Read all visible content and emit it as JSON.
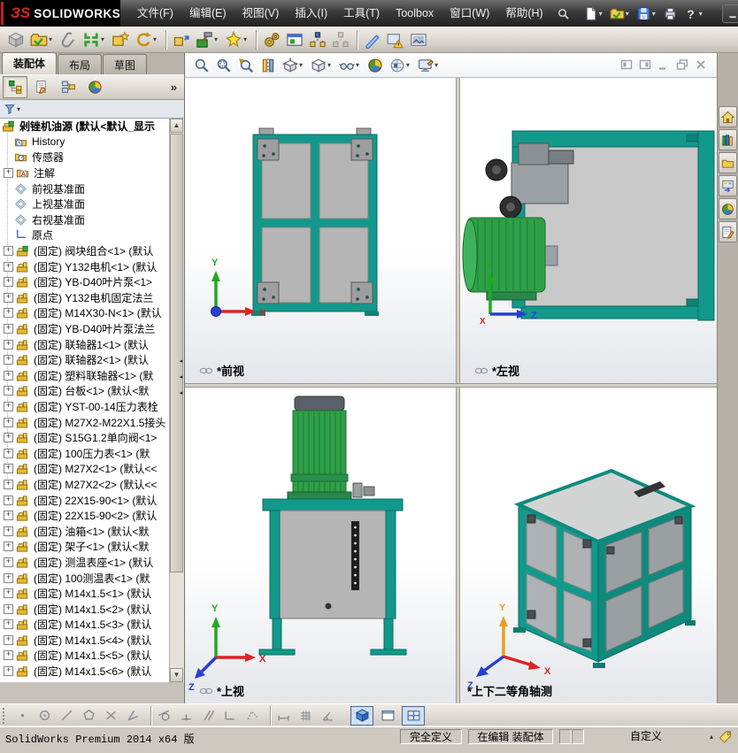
{
  "window": {
    "logo_mark": "ЗS",
    "logo_name": "SOLIDWORKS",
    "menus": [
      "文件(F)",
      "编辑(E)",
      "视图(V)",
      "插入(I)",
      "工具(T)",
      "Toolbox",
      "窗口(W)",
      "帮助(H)"
    ],
    "quick_actions": [
      {
        "icon": "new-doc",
        "dd": true
      },
      {
        "icon": "folder-open",
        "dd": true
      },
      {
        "icon": "save",
        "dd": true
      },
      {
        "icon": "print",
        "dd": false
      },
      {
        "icon": "help",
        "dd": true
      }
    ],
    "window_controls": [
      "minimize",
      "maximize",
      "close"
    ]
  },
  "colors": {
    "frame_teal": "#12998c",
    "motor_green": "#2fa047",
    "panel_grey": "#b5b5b5",
    "titlebar_dark": "#2a2a2a",
    "logo_red": "#c0201c",
    "selection_blue": "#49688f"
  },
  "assembly_toolbar": [
    {
      "icon": "cube-grey"
    },
    {
      "icon": "folder-open",
      "dd": true
    },
    {
      "icon": "paperclip"
    },
    {
      "icon": "mate",
      "dd": true
    },
    {
      "icon": "pic-star"
    },
    {
      "icon": "rotate",
      "dd": true
    },
    {
      "sep": true
    },
    {
      "icon": "move-arrow"
    },
    {
      "icon": "hammer-box",
      "dd": true
    },
    {
      "icon": "sparkle-star",
      "dd": true
    },
    {
      "sep": true
    },
    {
      "icon": "gears"
    },
    {
      "icon": "win-box"
    },
    {
      "icon": "explode"
    },
    {
      "icon": "explode-grey"
    },
    {
      "sep": true
    },
    {
      "icon": "blue-pen"
    },
    {
      "icon": "warn-pic"
    },
    {
      "icon": "picture"
    }
  ],
  "command_tabs": [
    {
      "label": "装配体",
      "active": true
    },
    {
      "label": "布局",
      "active": false
    },
    {
      "label": "草图",
      "active": false
    }
  ],
  "feature_manager": {
    "tabs": [
      "fm-tree",
      "fm-prop",
      "fm-config",
      "color-wheel"
    ],
    "more": "»"
  },
  "feature_tree": {
    "root": "剁锉机油源  (默认<默认_显示",
    "items": [
      {
        "icon": "history",
        "label": "History",
        "plus": false
      },
      {
        "icon": "sensors",
        "label": "传感器",
        "plus": false
      },
      {
        "icon": "annotations",
        "label": "注解",
        "plus": true
      },
      {
        "icon": "plane",
        "label": "前视基准面",
        "plus": false
      },
      {
        "icon": "plane",
        "label": "上视基准面",
        "plus": false
      },
      {
        "icon": "plane",
        "label": "右视基准面",
        "plus": false
      },
      {
        "icon": "origin",
        "label": "原点",
        "plus": false
      },
      {
        "icon": "asm",
        "label": "(固定) 阀块组合<1> (默认",
        "plus": true
      },
      {
        "icon": "part",
        "label": "(固定) Y132电机<1> (默认",
        "plus": true
      },
      {
        "icon": "part",
        "label": "(固定) YB-D40叶片泵<1>",
        "plus": true
      },
      {
        "icon": "part",
        "label": "(固定) Y132电机固定法兰",
        "plus": true
      },
      {
        "icon": "part",
        "label": "(固定) M14X30-N<1> (默认",
        "plus": true
      },
      {
        "icon": "part",
        "label": "(固定) YB-D40叶片泵法兰",
        "plus": true
      },
      {
        "icon": "part",
        "label": "(固定) 联轴器1<1> (默认",
        "plus": true
      },
      {
        "icon": "part",
        "label": "(固定) 联轴器2<1> (默认",
        "plus": true
      },
      {
        "icon": "part",
        "label": "(固定) 塑料联轴器<1> (默",
        "plus": true
      },
      {
        "icon": "part",
        "label": "(固定) 台板<1> (默认<默",
        "plus": true
      },
      {
        "icon": "part",
        "label": "(固定) YST-00-14压力表栓",
        "plus": true
      },
      {
        "icon": "part",
        "label": "(固定) M27X2-M22X1.5接头",
        "plus": true
      },
      {
        "icon": "part",
        "label": "(固定) S15G1.2单向阀<1>",
        "plus": true
      },
      {
        "icon": "part",
        "label": "(固定) 100压力表<1> (默",
        "plus": true
      },
      {
        "icon": "part",
        "label": "(固定) M27X2<1> (默认<<",
        "plus": true
      },
      {
        "icon": "part",
        "label": "(固定) M27X2<2> (默认<<",
        "plus": true
      },
      {
        "icon": "part",
        "label": "(固定) 22X15-90<1> (默认",
        "plus": true
      },
      {
        "icon": "part",
        "label": "(固定) 22X15-90<2> (默认",
        "plus": true
      },
      {
        "icon": "part",
        "label": "(固定) 油箱<1> (默认<默",
        "plus": true
      },
      {
        "icon": "part",
        "label": "(固定) 架子<1> (默认<默",
        "plus": true
      },
      {
        "icon": "part",
        "label": "(固定) 测温表座<1> (默认",
        "plus": true
      },
      {
        "icon": "part",
        "label": "(固定) 100测温表<1> (默",
        "plus": true
      },
      {
        "icon": "part",
        "label": "(固定) M14x1.5<1> (默认",
        "plus": true
      },
      {
        "icon": "part",
        "label": "(固定) M14x1.5<2> (默认",
        "plus": true
      },
      {
        "icon": "part",
        "label": "(固定) M14x1.5<3> (默认",
        "plus": true
      },
      {
        "icon": "part",
        "label": "(固定) M14x1.5<4> (默认",
        "plus": true
      },
      {
        "icon": "part",
        "label": "(固定) M14x1.5<5> (默认",
        "plus": true
      },
      {
        "icon": "part",
        "label": "(固定) M14x1.5<6> (默认",
        "plus": true
      }
    ]
  },
  "headsup_toolbar": [
    {
      "icon": "zoom-fit"
    },
    {
      "icon": "zoom-area"
    },
    {
      "icon": "zoom-prev"
    },
    {
      "icon": "section"
    },
    {
      "icon": "view-orient",
      "dd": true
    },
    {
      "icon": "cube-white",
      "dd": true
    },
    {
      "icon": "glasses",
      "dd": true
    },
    {
      "icon": "color-wheel"
    },
    {
      "icon": "scene-ball",
      "dd": true
    },
    {
      "icon": "monitor-edit",
      "dd": true
    }
  ],
  "viewport_controls": [
    "pane-left",
    "pane-right",
    "minimize",
    "restore",
    "close"
  ],
  "viewports": [
    {
      "name": "front",
      "label": "*前视",
      "chain": true,
      "axes": [
        "Y",
        "X"
      ]
    },
    {
      "name": "left",
      "label": "*左视",
      "chain": true,
      "axes": [
        "Y",
        "Z",
        "X"
      ]
    },
    {
      "name": "top",
      "label": "*上视",
      "chain": true,
      "axes": [
        "Y",
        "X",
        "Z"
      ]
    },
    {
      "name": "isometric",
      "label": "*上下二等角轴测",
      "chain": false,
      "axes": [
        "Y",
        "X",
        "Z"
      ]
    }
  ],
  "task_pane": [
    "home",
    "books",
    "folder",
    "palette-arrow",
    "color-wheel",
    "form-pencil"
  ],
  "quick_snaps": [
    {
      "icon": "snap-dot"
    },
    {
      "icon": "snap-circle"
    },
    {
      "icon": "snap-line"
    },
    {
      "icon": "snap-poly"
    },
    {
      "icon": "snap-x"
    },
    {
      "icon": "snap-angle"
    },
    {
      "sep": true
    },
    {
      "icon": "snap-tangent"
    },
    {
      "icon": "snap-mid"
    },
    {
      "icon": "snap-parallel"
    },
    {
      "icon": "snap-corner"
    },
    {
      "icon": "snap-points"
    },
    {
      "sep": true
    },
    {
      "icon": "snap-length"
    },
    {
      "icon": "snap-grid"
    },
    {
      "icon": "snap-angle2"
    }
  ],
  "view_buttons": [
    {
      "icon": "cube-blue",
      "pressed": true
    },
    {
      "icon": "pane-single",
      "pressed": false
    },
    {
      "icon": "pane-four",
      "pressed": true
    }
  ],
  "statusbar": {
    "left": "SolidWorks Premium 2014 x64 版",
    "fully_defined": "完全定义",
    "editing": "在编辑 装配体",
    "custom": "自定义"
  }
}
